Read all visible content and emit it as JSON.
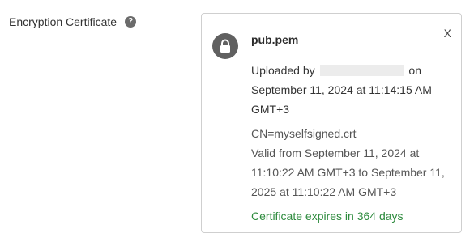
{
  "field": {
    "label": "Encryption Certificate",
    "help_icon": "question-mark-icon"
  },
  "certificate": {
    "filename": "pub.pem",
    "icon": "lock-icon",
    "close_label": "X",
    "uploaded_prefix": "Uploaded by",
    "uploaded_suffix": "on",
    "uploaded_date": "September 11, 2024 at 11:14:15 AM GMT+3",
    "cn": "CN=myselfsigned.crt",
    "valid_range": "Valid from September 11, 2024 at 11:10:22 AM GMT+3 to September 11, 2025 at 11:10:22 AM GMT+3",
    "expiry": "Certificate expires in 364 days",
    "expiry_color": "#2e8b3e"
  }
}
